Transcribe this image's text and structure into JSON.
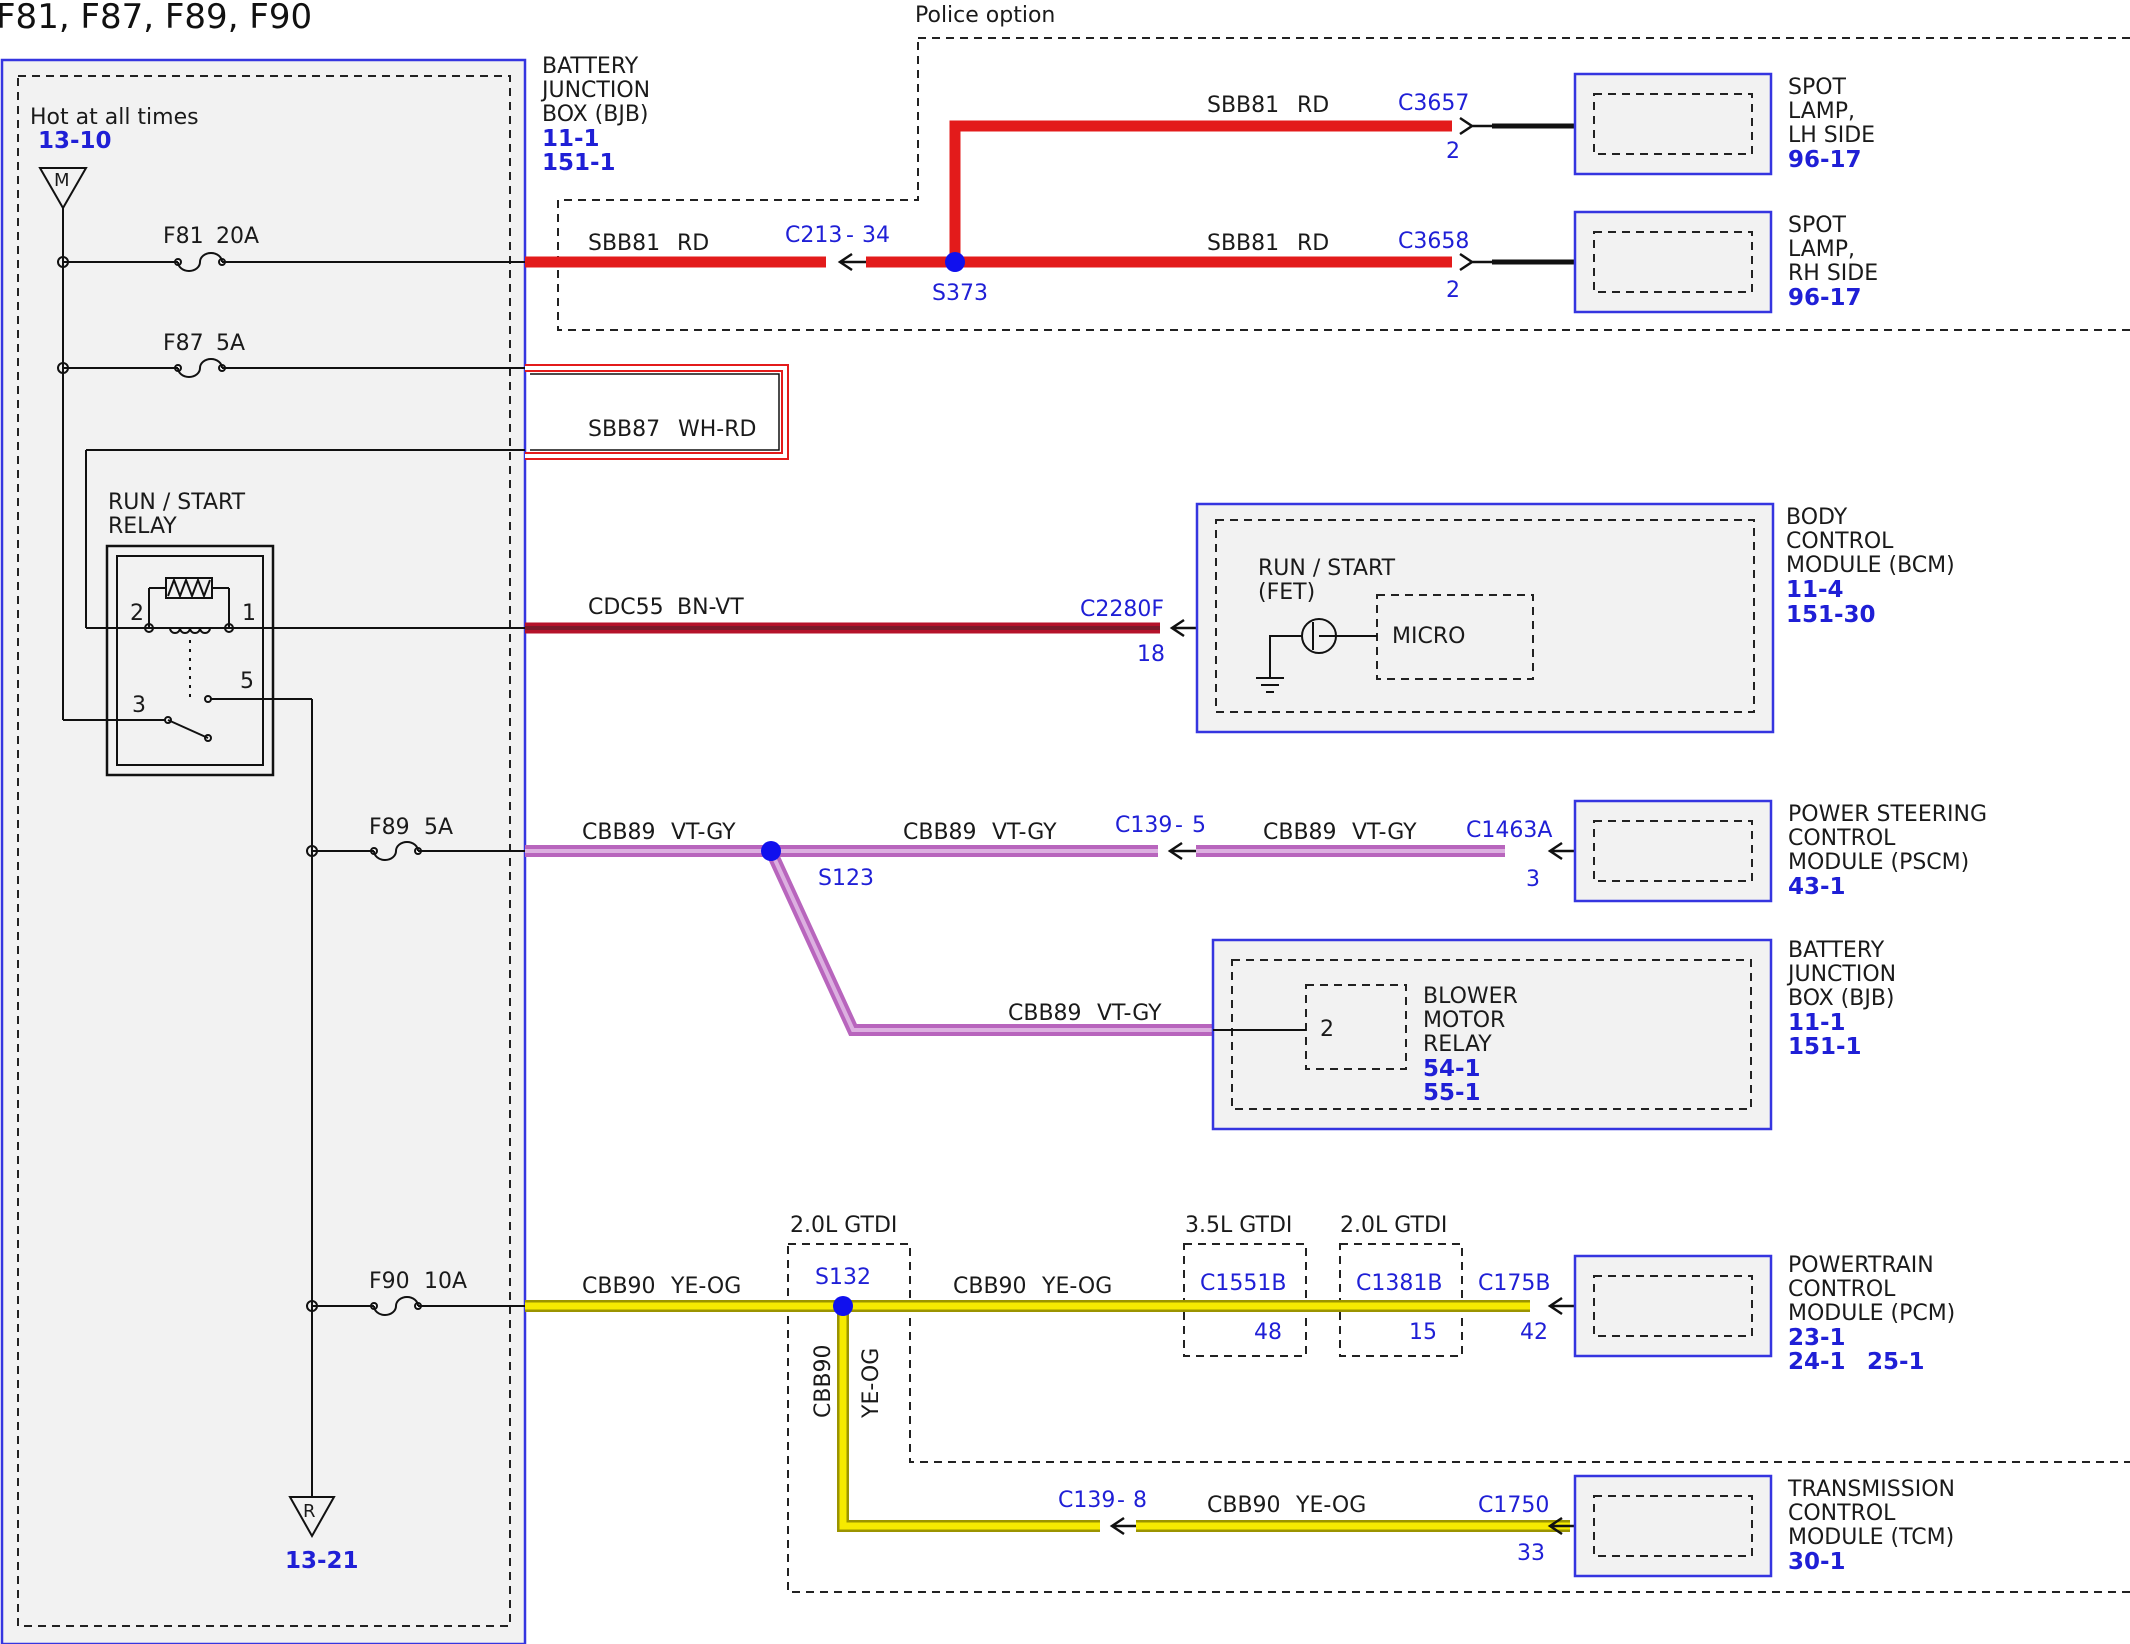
{
  "title": "F81, F87, F89, F90",
  "police_option": "Police option",
  "power_source": {
    "label": "Hot at all times",
    "ref": "13-10",
    "symbol_top": "M",
    "symbol_bottom": "R",
    "ref_bottom": "13-21"
  },
  "bjb": {
    "line1": "BATTERY",
    "line2": "JUNCTION",
    "line3": "BOX (BJB)",
    "ref1": "11-1",
    "ref2": "151-1"
  },
  "fuses": {
    "f81": {
      "name": "F81",
      "rating": "20A"
    },
    "f87": {
      "name": "F87",
      "rating": "5A"
    },
    "f89": {
      "name": "F89",
      "rating": "5A"
    },
    "f90": {
      "name": "F90",
      "rating": "10A"
    }
  },
  "relay": {
    "line1": "RUN / START",
    "line2": "RELAY",
    "pin1": "1",
    "pin2": "2",
    "pin3": "3",
    "pin5": "5"
  },
  "circuits": {
    "sbb81": {
      "id": "SBB81",
      "color": "RD"
    },
    "sbb87": {
      "id": "SBB87",
      "color": "WH-RD"
    },
    "cdc55": {
      "id": "CDC55",
      "color": "BN-VT"
    },
    "cbb89": {
      "id": "CBB89",
      "color": "VT-GY"
    },
    "cbb90": {
      "id": "CBB90",
      "color": "YE-OG"
    }
  },
  "connectors": {
    "c213": "C213",
    "c213_pin": "34",
    "c3657": "C3657",
    "c3657_pin": "2",
    "c3658": "C3658",
    "c3658_pin": "2",
    "c2280f": "C2280F",
    "c2280f_pin": "18",
    "c139a": "C139",
    "c139a_pin": "5",
    "c1463a": "C1463A",
    "c1463a_pin": "3",
    "c1551b": "C1551B",
    "c1551b_pin": "48",
    "c1381b": "C1381B",
    "c1381b_pin": "15",
    "c175b": "C175B",
    "c175b_pin": "42",
    "c139b": "C139",
    "c139b_pin": "8",
    "c1750": "C1750",
    "c1750_pin": "33",
    "dash": "-"
  },
  "splices": {
    "s373": "S373",
    "s123": "S123",
    "s132": "S132"
  },
  "options": {
    "gtdi20": "2.0L GTDI",
    "gtdi35": "3.5L GTDI"
  },
  "components": {
    "spot_lh": {
      "l1": "SPOT",
      "l2": "LAMP,",
      "l3": "LH SIDE",
      "ref": "96-17"
    },
    "spot_rh": {
      "l1": "SPOT",
      "l2": "LAMP,",
      "l3": "RH SIDE",
      "ref": "96-17"
    },
    "bcm": {
      "l1": "BODY",
      "l2": "CONTROL",
      "l3": "MODULE (BCM)",
      "ref1": "11-4",
      "ref2": "151-30",
      "inner1": "RUN / START",
      "inner2": "(FET)",
      "micro": "MICRO"
    },
    "pscm": {
      "l1": "POWER STEERING",
      "l2": "CONTROL",
      "l3": "MODULE (PSCM)",
      "ref": "43-1"
    },
    "bjb2": {
      "l1": "BATTERY",
      "l2": "JUNCTION",
      "l3": "BOX (BJB)",
      "ref1": "11-1",
      "ref2": "151-1"
    },
    "blower": {
      "l1": "BLOWER",
      "l2": "MOTOR",
      "l3": "RELAY",
      "ref1": "54-1",
      "ref2": "55-1",
      "pin": "2"
    },
    "pcm": {
      "l1": "POWERTRAIN",
      "l2": "CONTROL",
      "l3": "MODULE (PCM)",
      "ref1": "23-1",
      "ref2": "24-1",
      "ref3": "25-1"
    },
    "tcm": {
      "l1": "TRANSMISSION",
      "l2": "CONTROL",
      "l3": "MODULE (TCM)",
      "ref": "30-1"
    }
  },
  "wire_colors": {
    "rd": "#e31b1b",
    "bnvt": "#7a1a2a",
    "vtgy": "#d38ad6",
    "yeog": "#f2e600"
  }
}
